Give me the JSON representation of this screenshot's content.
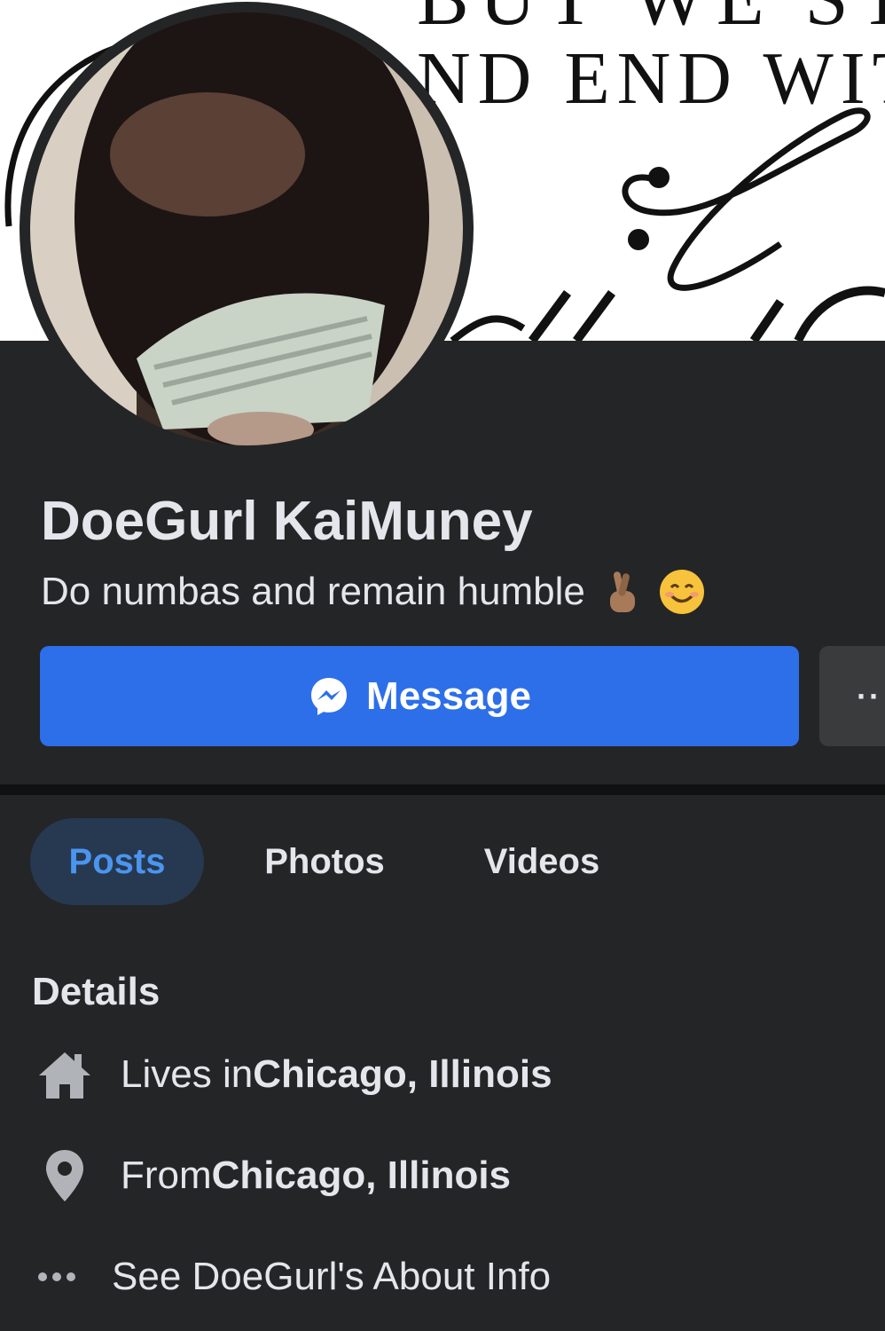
{
  "cover": {
    "text_line1": "BUT WE STAR",
    "text_line2": "ND END WIT"
  },
  "profile": {
    "name": "DoeGurl KaiMuney",
    "bio": "Do numbas and remain humble",
    "bio_emojis": [
      "crossed-fingers-emoji",
      "smiling-face-emoji"
    ]
  },
  "actions": {
    "message_label": "Message",
    "more_label": "··"
  },
  "tabs": [
    {
      "label": "Posts",
      "active": true
    },
    {
      "label": "Photos",
      "active": false
    },
    {
      "label": "Videos",
      "active": false
    }
  ],
  "details": {
    "title": "Details",
    "lives_prefix": "Lives in ",
    "lives_value": "Chicago, Illinois",
    "from_prefix": "From ",
    "from_value": "Chicago, Illinois",
    "about_link": "See DoeGurl's About Info"
  },
  "colors": {
    "background": "#242526",
    "primary": "#2d6fe9",
    "active_tab_bg": "#263951",
    "active_tab_text": "#4b95f0",
    "text": "#e4e6eb"
  }
}
